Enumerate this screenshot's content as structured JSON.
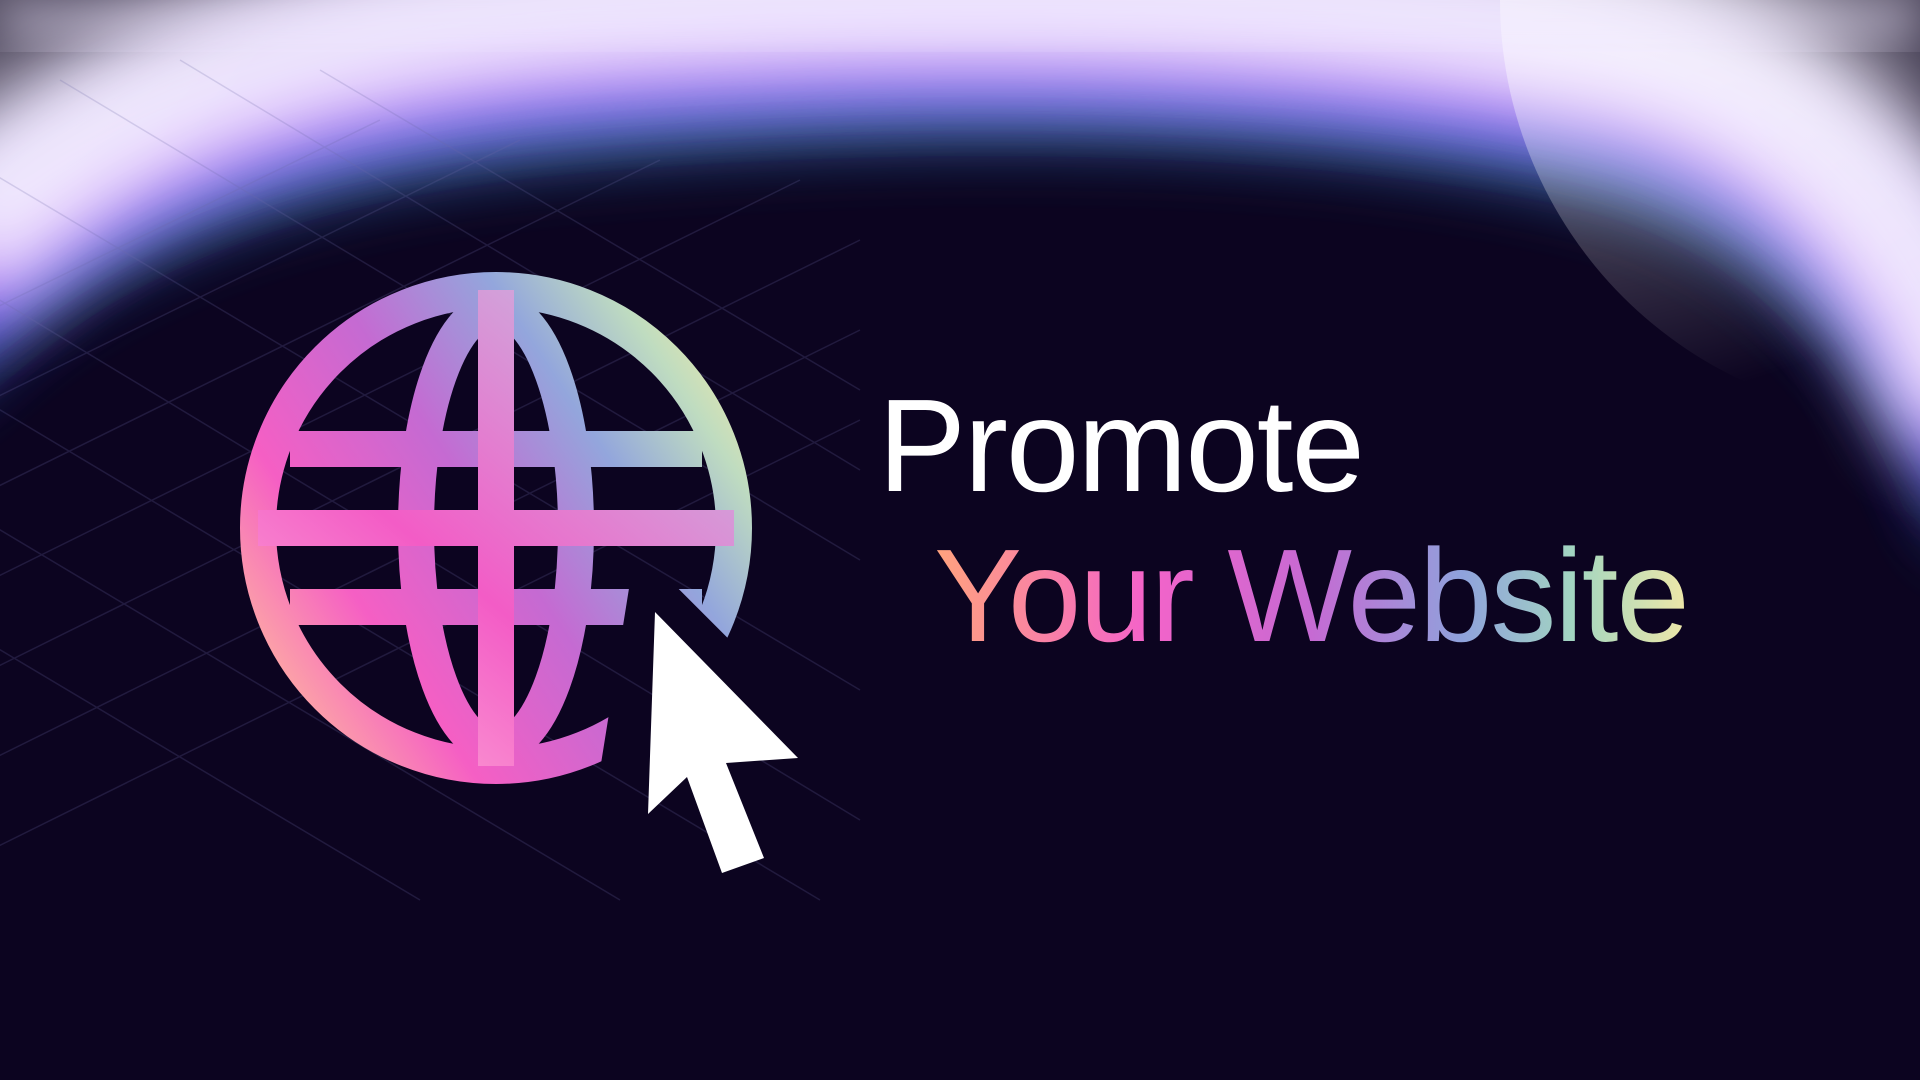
{
  "headline": {
    "line1": "Promote",
    "line2": "Your Website"
  },
  "icons": {
    "globe": "globe-icon",
    "cursor": "mouse-pointer-cursor-icon"
  },
  "colors": {
    "background": "#0c0420",
    "glow_purple": "#a855f7",
    "glow_blue": "#3b2ae0",
    "glow_cyan": "#5ee0f0",
    "text_white": "#ffffff",
    "gradient_pink": "#f463c9",
    "gradient_orange": "#ffa37d",
    "gradient_violet": "#c66ad3",
    "gradient_blue": "#8fa2dc",
    "gradient_yellow": "#efe7a8"
  }
}
